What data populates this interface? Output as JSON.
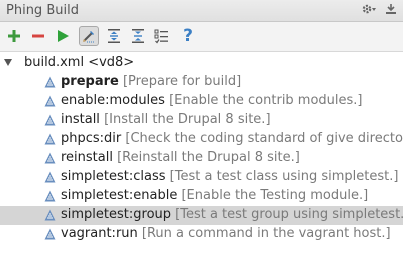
{
  "panel": {
    "title": "Phing Build",
    "gear_icon": "gear-icon",
    "collapse_icon": "hide-panel-icon"
  },
  "toolbar": {
    "buttons": [
      {
        "name": "add-build-file-button",
        "icon": "plus-icon",
        "color": "#3e9a3e"
      },
      {
        "name": "remove-build-file-button",
        "icon": "minus-icon",
        "color": "#d64541"
      },
      {
        "name": "run-target-button",
        "icon": "play-icon",
        "color": "#2fa23a"
      },
      {
        "name": "filter-targets-toggle",
        "icon": "filter-pencil-icon",
        "pressed": true
      },
      {
        "name": "expand-all-button",
        "icon": "expand-all-icon"
      },
      {
        "name": "collapse-all-button",
        "icon": "collapse-all-icon"
      },
      {
        "name": "properties-button",
        "icon": "properties-icon"
      },
      {
        "name": "help-button",
        "icon": "help-icon",
        "label": "?",
        "color": "#3b7fc4"
      }
    ]
  },
  "tree": {
    "root": {
      "label": "build.xml <vd8>"
    },
    "targets": [
      {
        "name": "prepare",
        "desc": "[Prepare for build]",
        "bold": true
      },
      {
        "name": "enable:modules",
        "desc": "[Enable the contrib modules.]"
      },
      {
        "name": "install",
        "desc": "[Install the Drupal 8 site.]"
      },
      {
        "name": "phpcs:dir",
        "desc": "[Check the coding standard of give directory"
      },
      {
        "name": "reinstall",
        "desc": "[Reinstall the Drupal 8 site.]"
      },
      {
        "name": "simpletest:class",
        "desc": "[Test a test class using simpletest.]"
      },
      {
        "name": "simpletest:enable",
        "desc": "[Enable the Testing module.]"
      },
      {
        "name": "simpletest:group",
        "desc": "[Test a test group using simpletest.]",
        "selected": true
      },
      {
        "name": "vagrant:run",
        "desc": "[Run a command in the vagrant host.]"
      }
    ]
  }
}
